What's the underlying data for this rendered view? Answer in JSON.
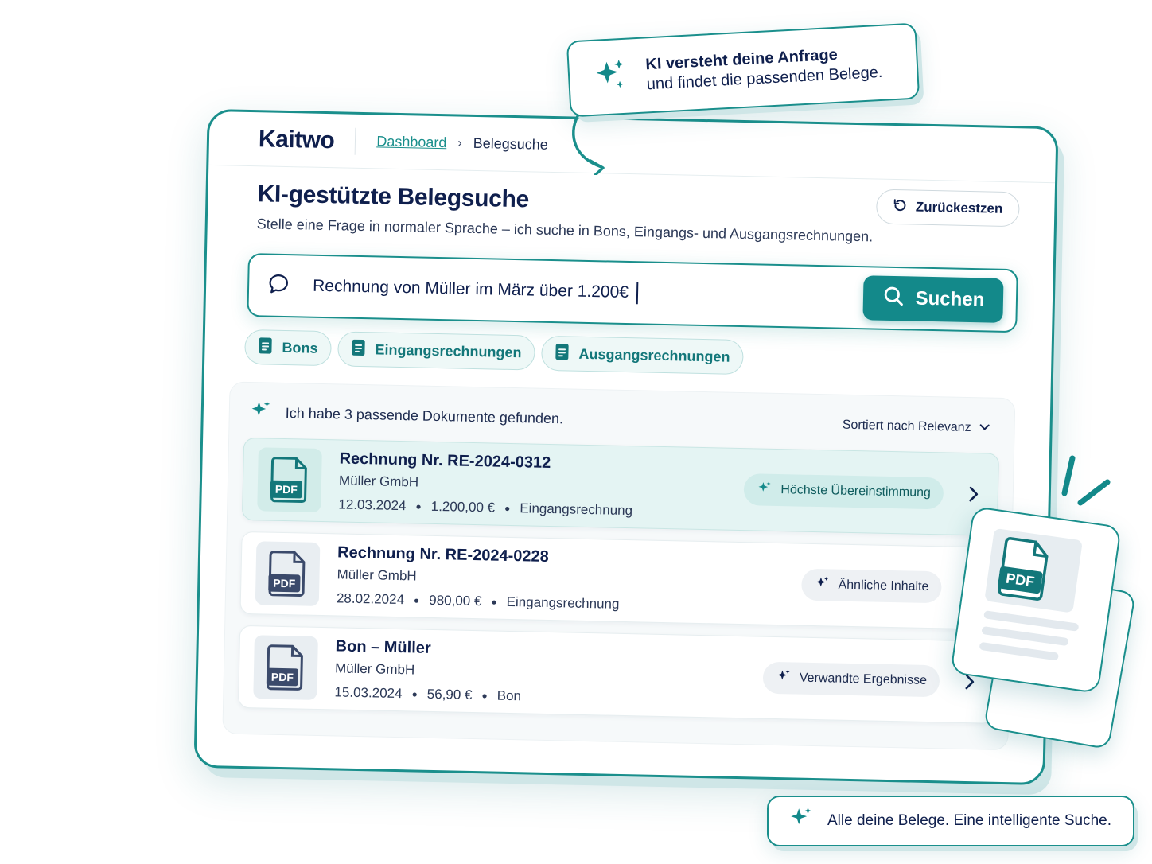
{
  "app": {
    "logo": "Kaitwo"
  },
  "breadcrumb": {
    "items": [
      {
        "label": "Dashboard",
        "link": true
      },
      {
        "label": "Belegsuche",
        "link": false
      }
    ],
    "separator": "›"
  },
  "page": {
    "title": "KI-gestützte Belegsuche",
    "subtitle": "Stelle eine Frage in normaler Sprache – ich suche in Bons, Eingangs- und Ausgangsrechnungen.",
    "reset_label": "Zurückestzen"
  },
  "search": {
    "value": "Rechnung von Müller im März über 1.200€",
    "button_label": "Suchen"
  },
  "filters": [
    {
      "label": "Bons",
      "icon": "document-icon"
    },
    {
      "label": "Eingangsrechnungen",
      "icon": "document-icon"
    },
    {
      "label": "Ausgangsrechnungen",
      "icon": "document-icon"
    }
  ],
  "results": {
    "summary": "Ich habe 3 passende Dokumente gefunden.",
    "sort_label": "Sortiert nach Relevanz",
    "items": [
      {
        "title": "Rechnung Nr. RE-2024-0312",
        "company": "Müller GmbH",
        "date": "12.03.2024",
        "amount": "1.200,00 €",
        "type": "Eingangsrechnung",
        "badge": "Höchste Übereinstimmung",
        "highlight": true,
        "thumb_label": "PDF"
      },
      {
        "title": "Rechnung Nr. RE-2024-0228",
        "company": "Müller GmbH",
        "date": "28.02.2024",
        "amount": "980,00 €",
        "type": "Eingangsrechnung",
        "badge": "Ähnliche Inhalte",
        "highlight": false,
        "thumb_label": "PDF"
      },
      {
        "title": "Bon – Müller",
        "company": "Müller GmbH",
        "date": "15.03.2024",
        "amount": "56,90 €",
        "type": "Bon",
        "badge": "Verwandte Ergebnisse",
        "highlight": false,
        "thumb_label": "PDF"
      }
    ]
  },
  "callouts": {
    "top_line1": "KI versteht deine Anfrage",
    "top_line2": "und findet die passenden Belege.",
    "bottom": "Alle deine Belege. Eine intelligente Suche."
  },
  "floating_doc": {
    "label": "PDF"
  },
  "colors": {
    "accent": "#13898a",
    "navy": "#0f1f4d",
    "highlight_bg": "#e4f4f3"
  }
}
